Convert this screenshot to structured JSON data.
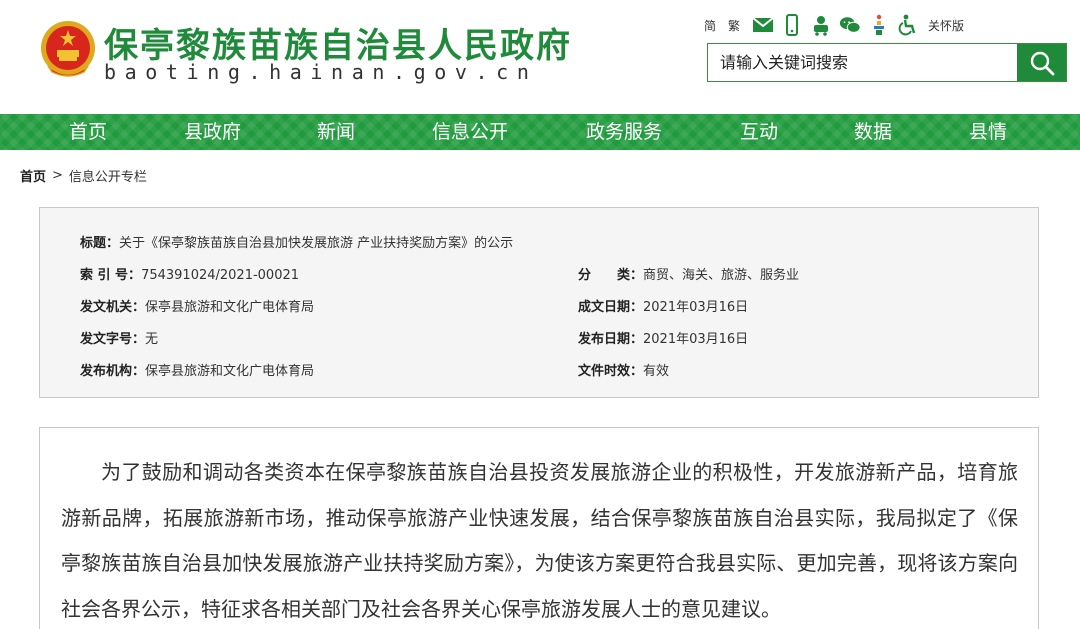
{
  "header": {
    "site_title": "保亭黎族苗族自治县人民政府",
    "site_domain": "baoting.hainan.gov.cn",
    "tools": {
      "simplified": "简",
      "traditional": "繁",
      "care_mode": "关怀版"
    },
    "search": {
      "placeholder": "请输入关键词搜索"
    }
  },
  "nav": {
    "items": [
      {
        "label": "首页"
      },
      {
        "label": "县政府"
      },
      {
        "label": "新闻"
      },
      {
        "label": "信息公开"
      },
      {
        "label": "政务服务"
      },
      {
        "label": "互动"
      },
      {
        "label": "数据"
      },
      {
        "label": "县情"
      }
    ]
  },
  "breadcrumb": {
    "home": "首页",
    "separator": ">",
    "current": "信息公开专栏"
  },
  "info": {
    "title_label": "标题：",
    "title_value": "关于《保亭黎族苗族自治县加快发展旅游 产业扶持奖励方案》的公示",
    "index_label": "索 引 号：",
    "index_value": "754391024/2021-00021",
    "category_label": "分　　类：",
    "category_value": "商贸、海关、旅游、服务业",
    "issuer_label": "发文机关：",
    "issuer_value": "保亭县旅游和文化广电体育局",
    "created_label": "成文日期：",
    "created_value": "2021年03月16日",
    "doc_no_label": "发文字号：",
    "doc_no_value": "无",
    "published_label": "发布日期：",
    "published_value": "2021年03月16日",
    "publisher_label": "发布机构：",
    "publisher_value": "保亭县旅游和文化广电体育局",
    "validity_label": "文件时效：",
    "validity_value": "有效"
  },
  "article": {
    "paragraph": "为了鼓励和调动各类资本在保亭黎族苗族自治县投资发展旅游企业的积极性，开发旅游新产品，培育旅游新品牌，拓展旅游新市场，推动保亭旅游产业快速发展，结合保亭黎族苗族自治县实际，我局拟定了《保亭黎族苗族自治县加快发展旅游产业扶持奖励方案》，为使该方案更符合我县实际、更加完善，现将该方案向社会各界公示，特征求各相关部门及社会各界关心保亭旅游发展人士的意见建议。"
  },
  "colors": {
    "brand_green": "#1f8b3a",
    "nav_green": "#1f9a3c",
    "emblem_red": "#d8261c",
    "emblem_gold": "#f2c230"
  }
}
